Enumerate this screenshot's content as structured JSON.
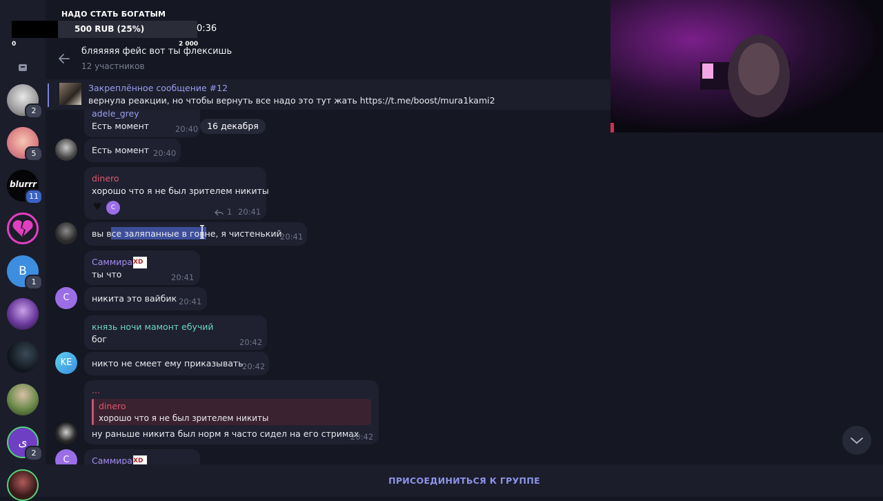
{
  "donation": {
    "title": "НАДО СТАТЬ БОГАТЫМ",
    "amount": "500 RUB (25%)",
    "time": "0:36",
    "min": "0",
    "max": "2 000",
    "progress_percent": 25
  },
  "sidebar": {
    "badges": [
      "2",
      "5",
      "11",
      "1",
      "2"
    ],
    "blurrr_text": "blurrr",
    "b_letter": "B",
    "s_letter": "ى"
  },
  "header": {
    "title": "бляяяяя фейс вот ты флексишь",
    "subtitle": "12 участников"
  },
  "pinned": {
    "title": "Закреплённое сообщение #12",
    "text": "вернула реакции, но чтобы вернуть все надо это тут жать https://t.me/boost/mura1kami2"
  },
  "date_pill": "16 декабря",
  "messages": {
    "m1": {
      "name": "adele_grey",
      "text": "Есть момент",
      "time": "20:40"
    },
    "m2": {
      "text": "Есть момент",
      "time": "20:40"
    },
    "m3": {
      "name": "dinero",
      "text": "хорошо что я не был зрителем никиты",
      "time": "20:41",
      "reply_count": "1",
      "reaction_letter": "C"
    },
    "m4": {
      "text_a": "вы ",
      "text_sel": "все заляпанные в говне",
      "text_b": ", я чистенький",
      "time": "20:41"
    },
    "m5": {
      "name": "Саммира",
      "name_tag": "XD",
      "text": "ты что",
      "time": "20:41"
    },
    "m6": {
      "avatar": "C",
      "text": "никита это вайбик",
      "time": "20:41"
    },
    "m7": {
      "name": "князь ночи мамонт ебучий",
      "text": "бог",
      "time": "20:42"
    },
    "m8": {
      "avatar": "KE",
      "text": "никто не смеет ему приказывать",
      "time": "20:42"
    },
    "m9": {
      "name": "...",
      "reply_name": "dinero",
      "reply_text": "хорошо что я не был зрителем никиты",
      "text": "ну раньше никита был норм я часто сидел на его стримах",
      "time": "20:42"
    },
    "m10": {
      "avatar": "C",
      "name": "Саммира",
      "name_tag": "XD"
    }
  },
  "join_button": "ПРИСОЕДИНИТЬСЯ К ГРУППЕ",
  "colors": {
    "accent": "#8d92e8",
    "dinero": "#e0566e",
    "sammira": "#a68cf2",
    "knyaz": "#6fd3c2",
    "avatar_c": "#9b6ee8",
    "avatar_ke": "#4fb3e8"
  }
}
